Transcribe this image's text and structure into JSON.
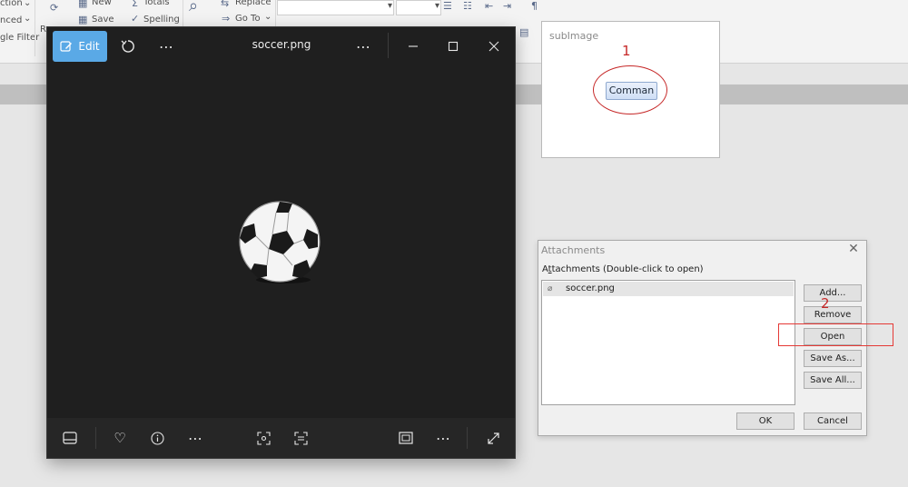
{
  "ribbon": {
    "item_action": "ction",
    "item_advanced": "nced",
    "item_filter": "gle Filter",
    "item_r": "R",
    "new_label": "New",
    "save_label": "Save",
    "totals_label": "Totals",
    "spelling_label": "Spelling",
    "replace_label": "Replace",
    "goto_label": "Go To"
  },
  "photos": {
    "edit_label": "Edit",
    "title": "soccer.png"
  },
  "subimage": {
    "title": "subImage",
    "button_label": "Comman"
  },
  "annotations": {
    "one": "1",
    "two": "2",
    "color": "#c62828"
  },
  "attachments": {
    "title": "Attachments",
    "label": "Attachments (Double-click to open)",
    "files": [
      "soccer.png"
    ],
    "buttons": {
      "add": "Add...",
      "remove": "Remove",
      "open": "Open",
      "save_as": "Save As...",
      "save_all": "Save All...",
      "ok": "OK",
      "cancel": "Cancel"
    }
  },
  "colors": {
    "edit_accent": "#5aa9e6",
    "photos_bg": "#1f1f1f"
  }
}
